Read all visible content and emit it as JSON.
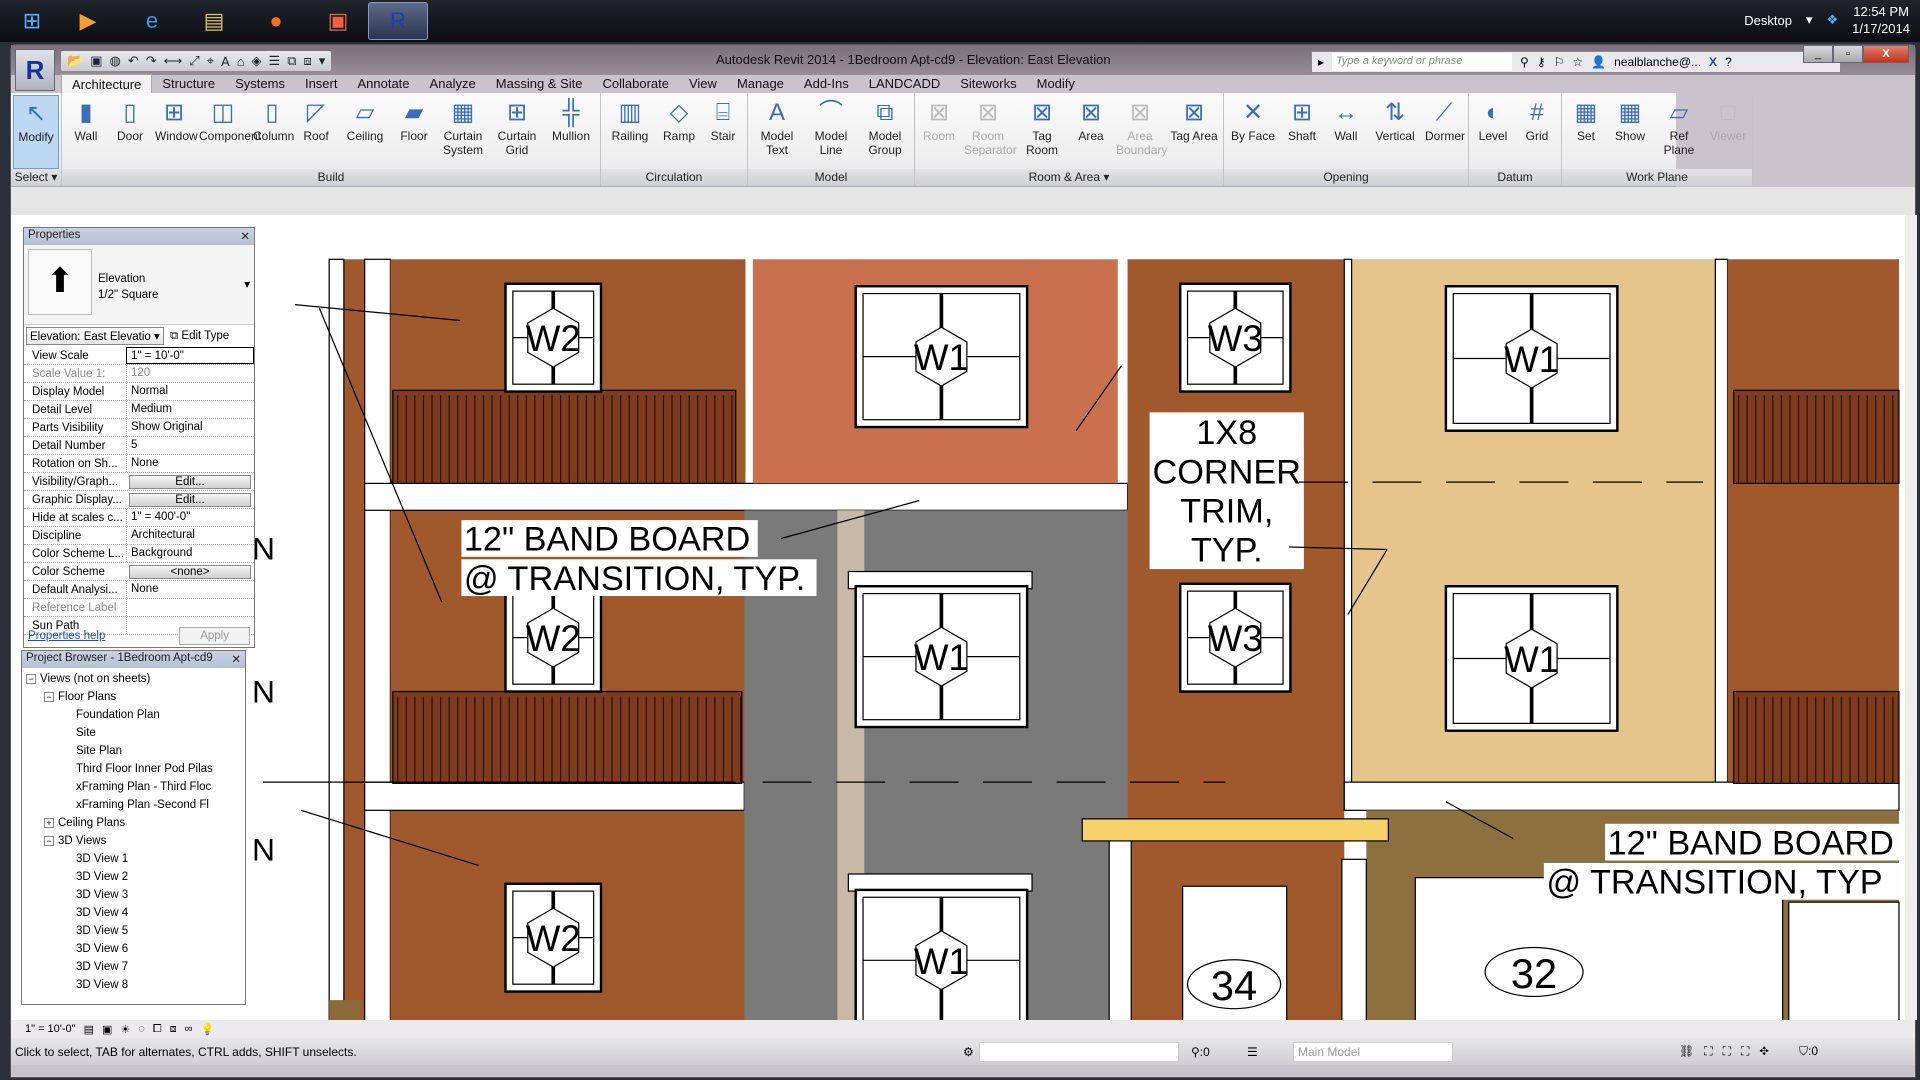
{
  "taskbar": {
    "desktop_label": "Desktop",
    "time": "12:54 PM",
    "date": "1/17/2014"
  },
  "window": {
    "title": "Autodesk Revit 2014 -    1Bedroom Apt-cd9 - Elevation: East Elevation",
    "search_placeholder": "Type a keyword or phrase",
    "user": "nealblanche@...",
    "close": "X"
  },
  "tabs": [
    "Architecture",
    "Structure",
    "Systems",
    "Insert",
    "Annotate",
    "Analyze",
    "Massing & Site",
    "Collaborate",
    "View",
    "Manage",
    "Add-Ins",
    "LANDCADD",
    "Siteworks",
    "Modify"
  ],
  "ribbon": {
    "panels": [
      {
        "label": "Select ▾",
        "tools": [
          {
            "label": "Modify",
            "icon": "cursor-icon",
            "glyph": "↖",
            "sel": true
          }
        ]
      },
      {
        "label": "Build",
        "tools": [
          {
            "label": "Wall",
            "glyph": "▮"
          },
          {
            "label": "Door",
            "glyph": "▯"
          },
          {
            "label": "Window",
            "glyph": "⊞"
          },
          {
            "label": "Component",
            "glyph": "◫"
          },
          {
            "label": "Column",
            "glyph": "▯"
          },
          {
            "label": "Roof",
            "glyph": "◸"
          },
          {
            "label": "Ceiling",
            "glyph": "▱"
          },
          {
            "label": "Floor",
            "glyph": "▰"
          },
          {
            "label": "Curtain System",
            "glyph": "▦"
          },
          {
            "label": "Curtain Grid",
            "glyph": "⊞"
          },
          {
            "label": "Mullion",
            "glyph": "╬"
          }
        ]
      },
      {
        "label": "Circulation",
        "tools": [
          {
            "label": "Railing",
            "glyph": "▥"
          },
          {
            "label": "Ramp",
            "glyph": "◇"
          },
          {
            "label": "Stair",
            "glyph": "⌸"
          }
        ]
      },
      {
        "label": "Model",
        "tools": [
          {
            "label": "Model Text",
            "glyph": "A"
          },
          {
            "label": "Model Line",
            "glyph": "⌒"
          },
          {
            "label": "Model Group",
            "glyph": "⧉"
          }
        ]
      },
      {
        "label": "Room & Area ▾",
        "tools": [
          {
            "label": "Room",
            "glyph": "⊠",
            "dis": true
          },
          {
            "label": "Room Separator",
            "glyph": "⊠",
            "dis": true
          },
          {
            "label": "Tag Room",
            "glyph": "⊠"
          },
          {
            "label": "Area",
            "glyph": "⊠"
          },
          {
            "label": "Area Boundary",
            "glyph": "⊠",
            "dis": true
          },
          {
            "label": "Tag Area",
            "glyph": "⊠"
          }
        ]
      },
      {
        "label": "Opening",
        "tools": [
          {
            "label": "By Face",
            "glyph": "✕"
          },
          {
            "label": "Shaft",
            "glyph": "⊞"
          },
          {
            "label": "Wall",
            "glyph": "↔"
          },
          {
            "label": "Vertical",
            "glyph": "⇅"
          },
          {
            "label": "Dormer",
            "glyph": "⟋"
          }
        ]
      },
      {
        "label": "Datum",
        "tools": [
          {
            "label": "Level",
            "glyph": "◐"
          },
          {
            "label": "Grid",
            "glyph": "#"
          }
        ]
      },
      {
        "label": "Work Plane",
        "tools": [
          {
            "label": "Set",
            "glyph": "▦"
          },
          {
            "label": "Show",
            "glyph": "▦"
          },
          {
            "label": "Ref Plane",
            "glyph": "▱"
          },
          {
            "label": "Viewer",
            "glyph": "□",
            "dis": true
          }
        ]
      }
    ]
  },
  "properties": {
    "title": "Properties",
    "type_name": "Elevation",
    "type_sub": "1/2\" Square",
    "instance_selector": "Elevation: East Elevatio",
    "edit_type": "Edit Type",
    "rows": [
      {
        "k": "View Scale",
        "v": "1\" = 10'-0\""
      },
      {
        "k": "Scale Value    1:",
        "v": "120"
      },
      {
        "k": "Display Model",
        "v": "Normal"
      },
      {
        "k": "Detail Level",
        "v": "Medium"
      },
      {
        "k": "Parts Visibility",
        "v": "Show Original"
      },
      {
        "k": "Detail Number",
        "v": "5"
      },
      {
        "k": "Rotation on Sh...",
        "v": "None"
      },
      {
        "k": "Visibility/Graph...",
        "v": "Edit..."
      },
      {
        "k": "Graphic Display...",
        "v": "Edit..."
      },
      {
        "k": "Hide at scales c...",
        "v": "1\" = 400'-0\""
      },
      {
        "k": "Discipline",
        "v": "Architectural"
      },
      {
        "k": "Color Scheme L...",
        "v": "Background"
      },
      {
        "k": "Color Scheme",
        "v": "<none>"
      },
      {
        "k": "Default Analysi...",
        "v": "None"
      },
      {
        "k": "Reference Label",
        "v": ""
      },
      {
        "k": "Sun Path",
        "v": ""
      }
    ],
    "help": "Properties help",
    "apply": "Apply"
  },
  "project_browser": {
    "title": "Project Browser - 1Bedroom Apt-cd9",
    "items": [
      {
        "label": "Views (not on sheets)",
        "lvl": 0,
        "exp": "−"
      },
      {
        "label": "Floor Plans",
        "lvl": 1,
        "exp": "−"
      },
      {
        "label": "Foundation Plan",
        "lvl": 2
      },
      {
        "label": "Site",
        "lvl": 2
      },
      {
        "label": "Site Plan",
        "lvl": 2
      },
      {
        "label": "Third Floor Inner Pod Pilas",
        "lvl": 2
      },
      {
        "label": "xFraming Plan - Third Floc",
        "lvl": 2
      },
      {
        "label": "xFraming Plan -Second Fl",
        "lvl": 2
      },
      {
        "label": "Ceiling Plans",
        "lvl": 1,
        "exp": "+"
      },
      {
        "label": "3D Views",
        "lvl": 1,
        "exp": "−"
      },
      {
        "label": "3D View 1",
        "lvl": 2
      },
      {
        "label": "3D View 2",
        "lvl": 2
      },
      {
        "label": "3D View 3",
        "lvl": 2
      },
      {
        "label": "3D View 4",
        "lvl": 2
      },
      {
        "label": "3D View 5",
        "lvl": 2
      },
      {
        "label": "3D View 6",
        "lvl": 2
      },
      {
        "label": "3D View 7",
        "lvl": 2
      },
      {
        "label": "3D View 8",
        "lvl": 2
      }
    ]
  },
  "drawing": {
    "window_tags": {
      "w1": "W1",
      "w2": "W2",
      "w3": "W3"
    },
    "note_band_1": "12\" BAND BOARD",
    "note_band_2": "@ TRANSITION, TYP.",
    "note_trim": [
      "1X8",
      "CORNER",
      "TRIM,",
      "TYP."
    ],
    "note_band_r1": "12\" BAND BOARD",
    "note_band_r2": "@ TRANSITION, TYP",
    "door_tag": "34",
    "garage_tag": "32",
    "grid_label": "N",
    "colors": {
      "brown": "#a0592c",
      "salmon": "#c9704f",
      "grey": "#7a7a7a",
      "tan": "#e6c58d",
      "beam": "#f7d26b",
      "rail": "#7d3a1c"
    }
  },
  "viewbar": {
    "scale": "1\" = 10'-0\""
  },
  "status": {
    "message": "Click to select, TAB for alternates, CTRL adds, SHIFT unselects.",
    "worksets": ":0",
    "model": "Main Model",
    "filter": ":0"
  }
}
